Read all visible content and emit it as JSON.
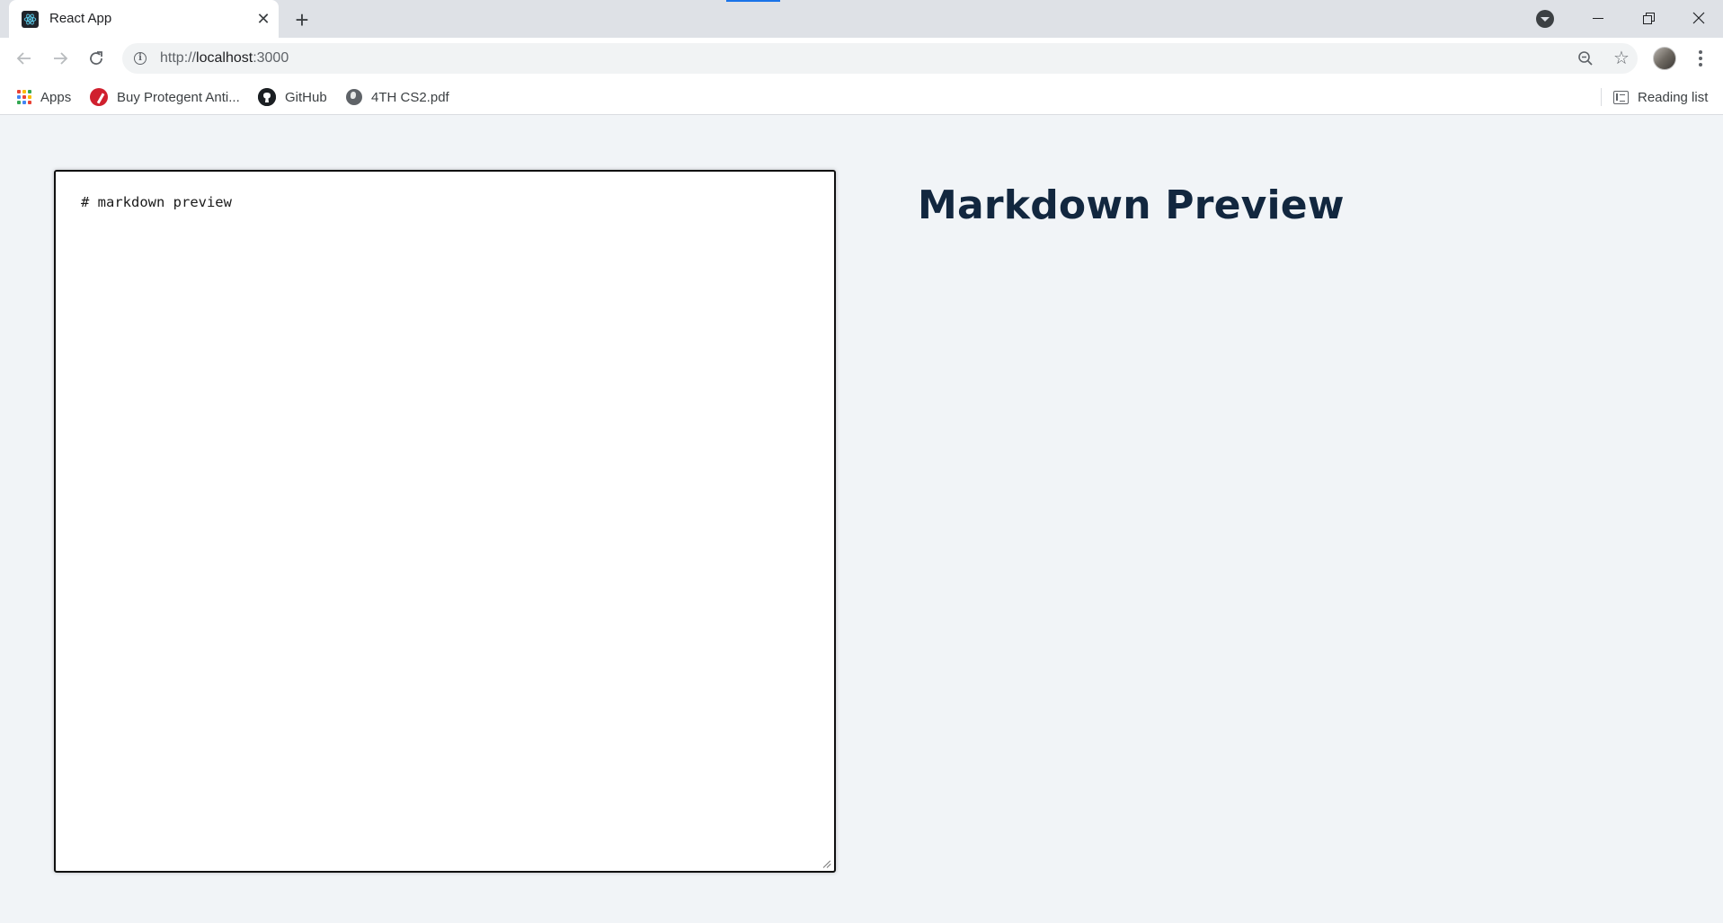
{
  "browser": {
    "tab": {
      "title": "React App",
      "favicon": "react-icon",
      "close_glyph": "✕"
    },
    "new_tab_glyph": "+",
    "address_bar": {
      "scheme": "http://",
      "host": "localhost",
      "port_path": ":3000"
    },
    "star_glyph": "☆",
    "bookmarks": [
      {
        "label": "Apps",
        "icon": "apps-grid-icon"
      },
      {
        "label": "Buy Protegent Anti...",
        "icon": "protegent-icon"
      },
      {
        "label": "GitHub",
        "icon": "github-icon"
      },
      {
        "label": "4TH CS2.pdf",
        "icon": "globe-icon"
      }
    ],
    "reading_list": {
      "label": "Reading list",
      "icon": "reading-list-icon"
    },
    "apps_colors": [
      "#ea4335",
      "#fbbc04",
      "#34a853",
      "#4285f4",
      "#ea4335",
      "#fbbc04",
      "#34a853",
      "#4285f4",
      "#ea4335"
    ]
  },
  "app": {
    "editor_value": "# markdown preview",
    "preview_heading": "Markdown Preview",
    "colors": {
      "heading": "#12273f",
      "background": "#f1f4f7"
    }
  }
}
